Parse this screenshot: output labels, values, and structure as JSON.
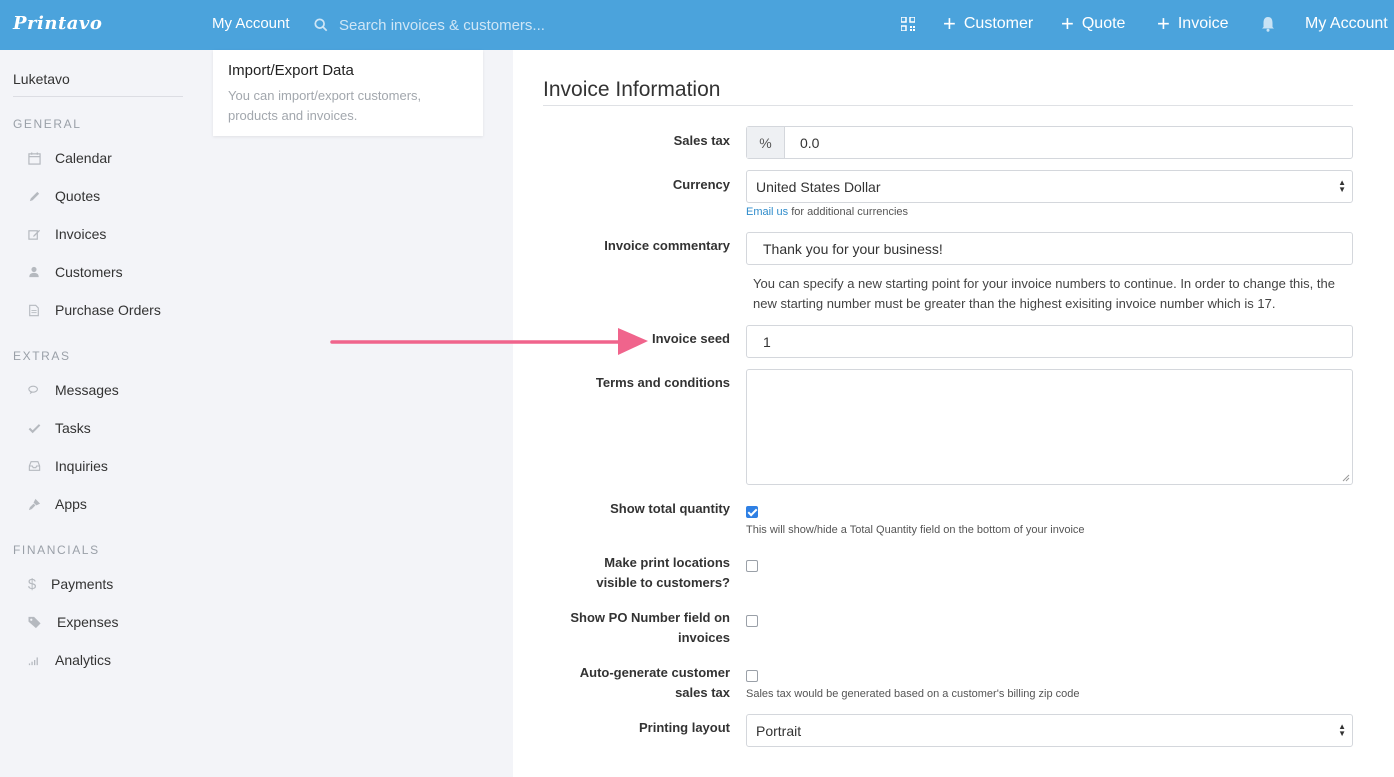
{
  "nav": {
    "logo": "Printavo",
    "my_account_left": "My Account",
    "search_placeholder": "Search invoices & customers...",
    "customer": "Customer",
    "quote": "Quote",
    "invoice": "Invoice",
    "my_account_right": "My Account"
  },
  "sidebar": {
    "user": "Luketavo",
    "sections": [
      {
        "title": "GENERAL",
        "items": [
          {
            "label": "Calendar",
            "icon": "calendar-icon"
          },
          {
            "label": "Quotes",
            "icon": "pencil-icon"
          },
          {
            "label": "Invoices",
            "icon": "edit-icon"
          },
          {
            "label": "Customers",
            "icon": "user-icon"
          },
          {
            "label": "Purchase Orders",
            "icon": "document-icon"
          }
        ]
      },
      {
        "title": "EXTRAS",
        "items": [
          {
            "label": "Messages",
            "icon": "chat-icon"
          },
          {
            "label": "Tasks",
            "icon": "check-icon"
          },
          {
            "label": "Inquiries",
            "icon": "inbox-icon"
          },
          {
            "label": "Apps",
            "icon": "plug-icon"
          }
        ]
      },
      {
        "title": "FINANCIALS",
        "items": [
          {
            "label": "Payments",
            "icon": "dollar-icon"
          },
          {
            "label": "Expenses",
            "icon": "tags-icon"
          },
          {
            "label": "Analytics",
            "icon": "signal-icon"
          }
        ]
      }
    ]
  },
  "popover": {
    "title": "Import/Export Data",
    "description": "You can import/export customers, products and invoices."
  },
  "form": {
    "title": "Invoice Information",
    "sales_tax": {
      "label": "Sales tax",
      "addon": "%",
      "value": "0.0"
    },
    "currency": {
      "label": "Currency",
      "value": "United States Dollar",
      "help_link": "Email us",
      "help_text": " for additional currencies"
    },
    "commentary": {
      "label": "Invoice commentary",
      "value": "Thank you for your business!"
    },
    "seed_note": "You can specify a new starting point for your invoice numbers to continue. In order to change this, the new starting number must be greater than the highest exisiting invoice number which is 17.",
    "seed": {
      "label": "Invoice seed",
      "value": "1"
    },
    "terms": {
      "label": "Terms and conditions",
      "value": ""
    },
    "show_total_qty": {
      "label": "Show total quantity",
      "checked": true,
      "help": "This will show/hide a Total Quantity field on the bottom of your invoice"
    },
    "print_locations": {
      "label_line1": "Make print locations",
      "label_line2": "visible to customers?",
      "checked": false
    },
    "po_number": {
      "label_line1": "Show PO Number field on",
      "label_line2": "invoices",
      "checked": false
    },
    "auto_tax": {
      "label_line1": "Auto-generate customer",
      "label_line2": "sales tax",
      "checked": false,
      "help": "Sales tax would be generated based on a customer's billing zip code"
    },
    "printing_layout": {
      "label": "Printing layout",
      "value": "Portrait"
    }
  },
  "colors": {
    "nav_bg": "#4ba3dc",
    "arrow": "#f0648c",
    "checkbox_checked": "#2f80e4",
    "link": "#2f8ccb"
  }
}
